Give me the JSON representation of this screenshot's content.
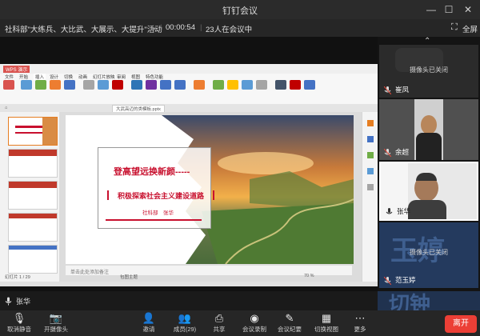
{
  "window": {
    "title": "钉钉会议",
    "controls": [
      "minimize-icon",
      "maximize-icon",
      "close-icon"
    ]
  },
  "infobar": {
    "meeting_name": "社科部\"大练兵、大比武、大展示、大提升\"活动",
    "timer": "00:00:54",
    "participants_status": "23人在会议中",
    "fullscreen_label": "全屏"
  },
  "ppt": {
    "app_tab": "WPS 演示",
    "menu": [
      "文件",
      "开始",
      "插入",
      "设计",
      "切换",
      "动画",
      "幻灯片放映",
      "审阅",
      "视图",
      "特色功能"
    ],
    "doc_tab": "大武高迈的类模板.pptx",
    "slide_title": "登高望远换新颜-----",
    "slide_subtitle": "积极探索社会主义建设道路",
    "slide_author": "社科部　张华",
    "notes_placeholder": "单击此处添加备注",
    "status_left": "幻灯片 1 / 29",
    "status_mid": "包图主题",
    "zoom": "70 %"
  },
  "participants": [
    {
      "name": "崔凤",
      "camera_off_text": "摄像头已关闭",
      "camera": "off"
    },
    {
      "name": "余超",
      "camera_off_text": "",
      "camera": "on"
    },
    {
      "name": "张华",
      "camera_off_text": "",
      "camera": "on"
    },
    {
      "name": "范玉婷",
      "camera_off_text": "摄像头已关闭",
      "camera": "off",
      "bg_text": "玉婷"
    }
  ],
  "speaking": {
    "name": "张华"
  },
  "toolbar": {
    "mute_label": "取消静音",
    "camera_label": "开摄像头",
    "invite_label": "邀请",
    "members_label": "成员(29)",
    "share_label": "共享",
    "record_label": "会议录制",
    "minutes_label": "会议纪要",
    "switch_view_label": "切换视图",
    "more_label": "更多",
    "leave_label": "离开"
  },
  "colors": {
    "accent": "#ec3f36",
    "slide_red": "#c8102e"
  }
}
